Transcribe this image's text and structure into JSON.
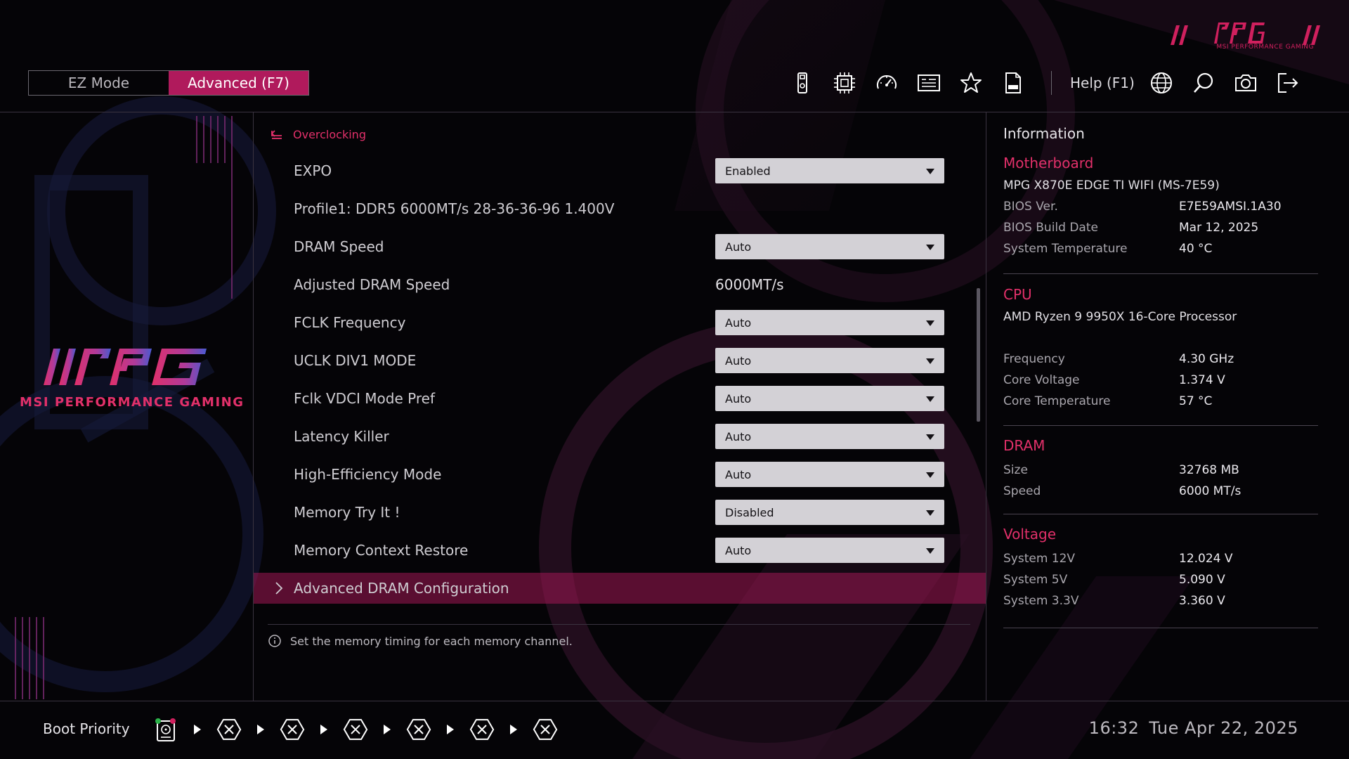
{
  "header": {
    "brand_tagline": "MSI PERFORMANCE GAMING",
    "mode_ez": "EZ Mode",
    "mode_advanced": "Advanced (F7)",
    "help": "Help (F1)",
    "icons": [
      "usb-device-icon",
      "cpu-chip-icon",
      "speedometer-icon",
      "hardware-monitor-icon",
      "favorites-star-icon",
      "file-log-icon",
      "language-globe-icon",
      "search-icon",
      "screenshot-camera-icon",
      "exit-icon"
    ]
  },
  "sidebar": {
    "brand_tagline": "MSI PERFORMANCE GAMING"
  },
  "settings": {
    "breadcrumb": "Overclocking",
    "rows": [
      {
        "label": "EXPO",
        "value": "Enabled"
      },
      {
        "label": "Profile1: DDR5 6000MT/s 28-36-36-96 1.400V"
      },
      {
        "label": "DRAM Speed",
        "value": "Auto"
      },
      {
        "label": "Adjusted DRAM Speed",
        "value": "6000MT/s"
      },
      {
        "label": "FCLK Frequency",
        "value": "Auto"
      },
      {
        "label": "UCLK DIV1 MODE",
        "value": "Auto"
      },
      {
        "label": "Fclk VDCI Mode Pref",
        "value": "Auto"
      },
      {
        "label": "Latency Killer",
        "value": "Auto"
      },
      {
        "label": "High-Efficiency Mode",
        "value": "Auto"
      },
      {
        "label": "Memory Try It !",
        "value": "Disabled"
      },
      {
        "label": "Memory Context Restore",
        "value": "Auto"
      },
      {
        "label": "Advanced DRAM Configuration"
      }
    ],
    "hint": "Set the memory timing for each memory channel."
  },
  "info": {
    "title": "Information",
    "motherboard": {
      "heading": "Motherboard",
      "model": "MPG X870E EDGE TI WIFI (MS-7E59)",
      "bios_ver_label": "BIOS Ver.",
      "bios_ver": "E7E59AMSI.1A30",
      "bios_date_label": "BIOS Build Date",
      "bios_date": "Mar 12, 2025",
      "sys_temp_label": "System Temperature",
      "sys_temp": "40 °C"
    },
    "cpu": {
      "heading": "CPU",
      "model": "AMD Ryzen 9 9950X 16-Core Processor",
      "freq_label": "Frequency",
      "freq": "4.30 GHz",
      "vcore_label": "Core Voltage",
      "vcore": "1.374 V",
      "temp_label": "Core Temperature",
      "temp": "57 °C"
    },
    "dram": {
      "heading": "DRAM",
      "size_label": "Size",
      "size": "32768 MB",
      "speed_label": "Speed",
      "speed": "6000 MT/s"
    },
    "voltage": {
      "heading": "Voltage",
      "v12_label": "System 12V",
      "v12": "12.024 V",
      "v5_label": "System 5V",
      "v5": "5.090 V",
      "v33_label": "System 3.3V",
      "v33": "3.360 V"
    }
  },
  "footer": {
    "boot_label": "Boot Priority",
    "time": "16:32",
    "date": "Tue Apr 22, 2025"
  },
  "colors": {
    "accent": "#e2306a",
    "active_tab": "#b01a5c",
    "selected_row": "#8a1548"
  }
}
